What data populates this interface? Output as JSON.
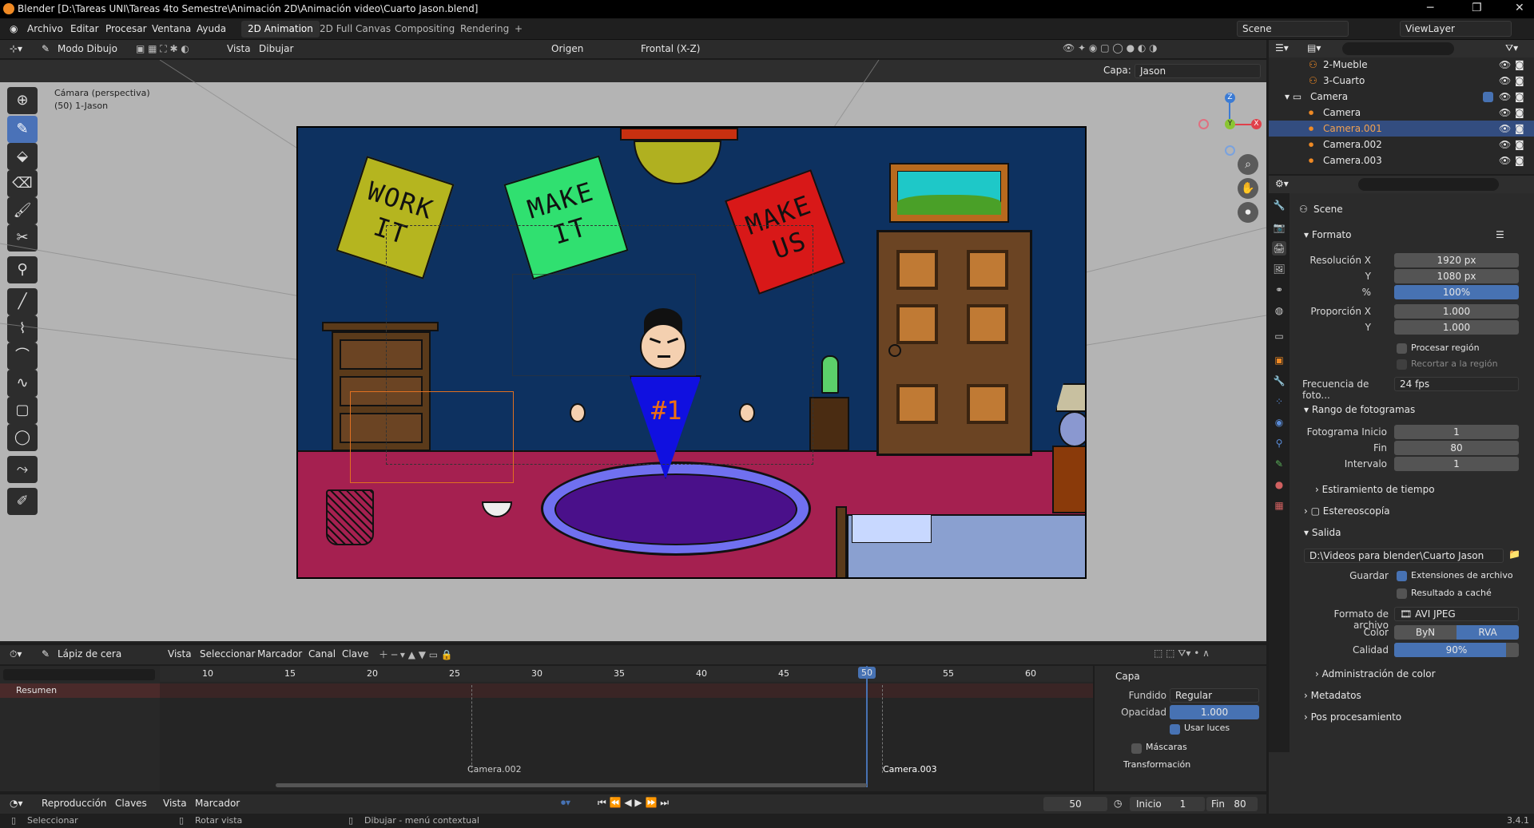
{
  "window": {
    "title": "Blender [D:\\Tareas UNI\\Tareas 4to Semestre\\Animación 2D\\Animación video\\Cuarto Jason.blend]",
    "minimize": "─",
    "maximize": "❐",
    "close": "✕"
  },
  "menu": [
    "Archivo",
    "Editar",
    "Procesar",
    "Ventana",
    "Ayuda"
  ],
  "workspaces": [
    "2D Animation",
    "2D Full Canvas",
    "Compositing",
    "Rendering",
    "+"
  ],
  "scene_field": "Scene",
  "viewlayer_field": "ViewLayer",
  "viewport": {
    "mode": "Modo Dibujo",
    "menus": [
      "Vista",
      "Dibujar"
    ],
    "origin": "Origen",
    "view_axis": "Frontal (X-Z)",
    "layer_label": "Capa:",
    "layer_value": "Jason",
    "overlay_title": "Cámara (perspectiva)",
    "overlay_sub": "(50) 1-Jason",
    "gizmo": {
      "z": "Z",
      "y": "Y",
      "x": "X"
    },
    "posters": [
      "WORK IT",
      "MAKE IT",
      "MAKE US"
    ],
    "shirt_text": "#1"
  },
  "outliner": {
    "rows": [
      {
        "name": "2-Mueble",
        "indent": 1
      },
      {
        "name": "3-Cuarto",
        "indent": 1
      },
      {
        "name": "Camera",
        "indent": 0
      },
      {
        "name": "Camera",
        "indent": 1
      },
      {
        "name": "Camera.001",
        "indent": 1
      },
      {
        "name": "Camera.002",
        "indent": 1
      },
      {
        "name": "Camera.003",
        "indent": 1
      }
    ]
  },
  "properties": {
    "scene": "Scene",
    "formato": "Formato",
    "res_x_label": "Resolución X",
    "res_x": "1920 px",
    "res_y_label": "Y",
    "res_y": "1080 px",
    "pct_label": "%",
    "pct": "100%",
    "asp_x_label": "Proporción X",
    "asp_x": "1.000",
    "asp_y_label": "Y",
    "asp_y": "1.000",
    "render_region": "Procesar región",
    "crop_region": "Recortar a la región",
    "fps_label": "Frecuencia de foto...",
    "fps": "24 fps",
    "frame_range": "Rango de fotogramas",
    "start_label": "Fotograma Inicio",
    "start": "1",
    "end_label": "Fin",
    "end": "80",
    "step_label": "Intervalo",
    "step": "1",
    "time_stretch": "Estiramiento de tiempo",
    "stereo": "Estereoscopía",
    "output": "Salida",
    "path": "D:\\Videos para blender\\Cuarto Jason",
    "save_label": "Guardar",
    "file_ext": "Extensiones de archivo",
    "cache": "Resultado a caché",
    "format_label": "Formato de archivo",
    "format": "AVI JPEG",
    "color_label": "Color",
    "bw": "ByN",
    "rgb": "RVA",
    "quality_label": "Calidad",
    "quality": "90%",
    "quality_fill": 0.9,
    "color_mgmt": "Administración de color",
    "metadata": "Metadatos",
    "post": "Pos procesamiento"
  },
  "timeline": {
    "mode": "Lápiz de cera",
    "menus": [
      "Vista",
      "Seleccionar",
      "Marcador",
      "Canal",
      "Clave"
    ],
    "ticks": [
      "10",
      "15",
      "20",
      "25",
      "30",
      "35",
      "40",
      "45",
      "50",
      "55",
      "60"
    ],
    "current": "50",
    "summary": "Resumen",
    "markers": [
      "Camera.002",
      "Camera.003"
    ],
    "layer_panel": "Capa",
    "blend_label": "Fundido",
    "blend": "Regular",
    "opacity_label": "Opacidad",
    "opacity": "1.000",
    "use_lights": "Usar luces",
    "masks": "Máscaras",
    "transform": "Transformación"
  },
  "playback": {
    "menus": [
      "Reproducción",
      "Claves",
      "Vista",
      "Marcador"
    ],
    "frame": "50",
    "start_label": "Inicio",
    "start": "1",
    "end_label": "Fin",
    "end": "80"
  },
  "status": {
    "select": "Seleccionar",
    "rotate": "Rotar vista",
    "draw": "Dibujar - menú contextual",
    "version": "3.4.1"
  }
}
